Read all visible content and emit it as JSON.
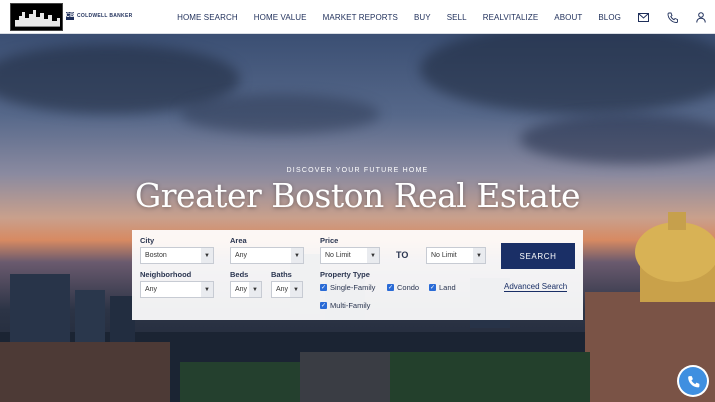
{
  "header": {
    "brand_text": "COLDWELL BANKER",
    "brand_mark": "CB",
    "nav": [
      "HOME SEARCH",
      "HOME VALUE",
      "MARKET REPORTS",
      "BUY",
      "SELL",
      "REALVITALIZE",
      "ABOUT",
      "BLOG"
    ],
    "icons": [
      "mail-icon",
      "phone-icon",
      "user-icon"
    ]
  },
  "hero": {
    "tagline": "DISCOVER YOUR FUTURE HOME",
    "headline": "Greater Boston Real Estate"
  },
  "search": {
    "city_label": "City",
    "city_value": "Boston",
    "area_label": "Area",
    "area_value": "Any",
    "price_label": "Price",
    "price_min": "No Limit",
    "price_to": "TO",
    "price_max": "No Limit",
    "neighborhood_label": "Neighborhood",
    "neighborhood_value": "Any",
    "beds_label": "Beds",
    "beds_value": "Any",
    "baths_label": "Baths",
    "baths_value": "Any",
    "property_type_label": "Property Type",
    "types": [
      {
        "label": "Single-Family",
        "checked": true
      },
      {
        "label": "Condo",
        "checked": true
      },
      {
        "label": "Land",
        "checked": true
      },
      {
        "label": "Multi-Family",
        "checked": true
      }
    ],
    "search_button": "SEARCH",
    "advanced_link": "Advanced Search"
  },
  "colors": {
    "brand_navy": "#1a2f66",
    "checkbox_blue": "#2a6bd6",
    "fab_blue": "#3f8fe0"
  }
}
